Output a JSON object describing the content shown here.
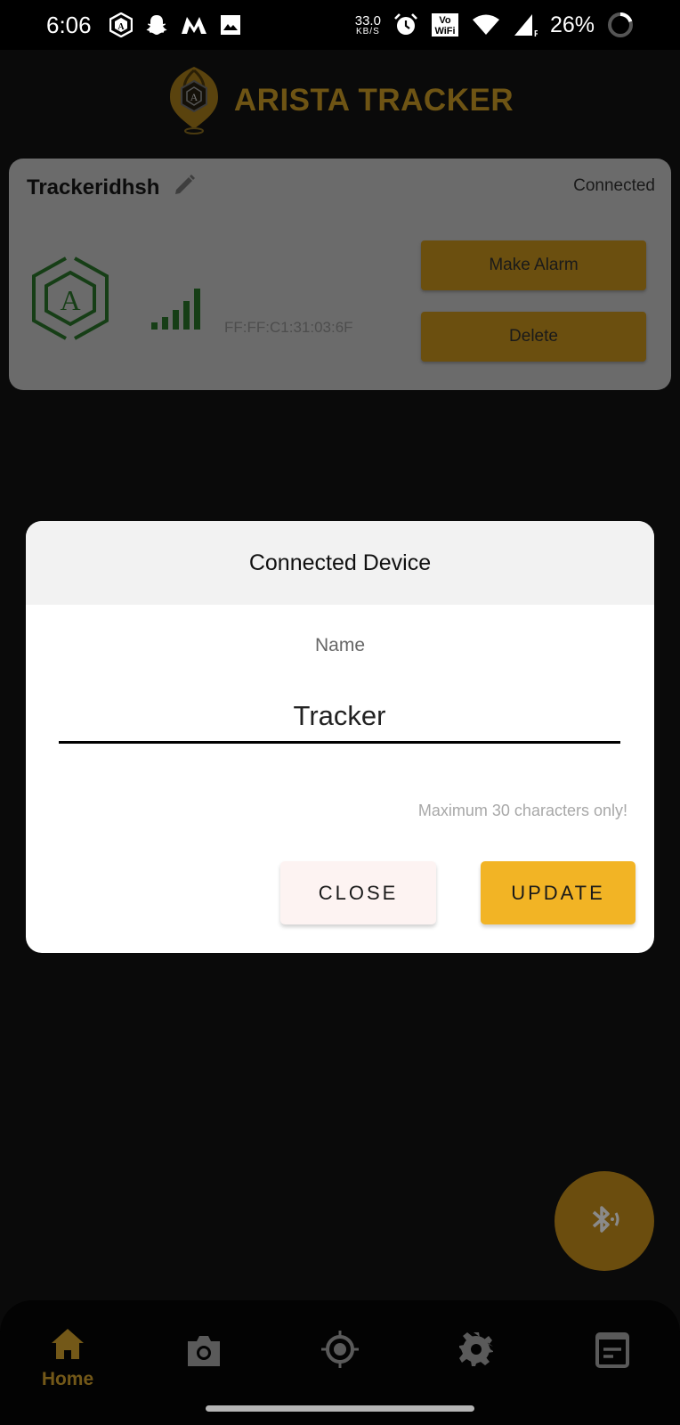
{
  "status_bar": {
    "time": "6:06",
    "notification_icons": [
      "arista-app-icon",
      "snapchat-icon",
      "myntra-icon",
      "gallery-icon"
    ],
    "net_speed_value": "33.0",
    "net_speed_unit": "KB/S",
    "system_icons": [
      "alarm-icon",
      "vowifi-icon",
      "wifi-icon",
      "cell-signal-roaming-icon"
    ],
    "battery_percent": "26%"
  },
  "header": {
    "app_title": "ARISTA TRACKER",
    "brand_color": "#6e5414"
  },
  "device_card": {
    "device_name": "Trackeridhsh",
    "connection_status": "Connected",
    "mac_address": "FF:FF:C1:31:03:6F",
    "signal_level": "4/4",
    "make_alarm_label": "Make Alarm",
    "delete_label": "Delete"
  },
  "dialog": {
    "title": "Connected Device",
    "field_label": "Name",
    "name_value": "Tracker",
    "hint": "Maximum 30 characters only!",
    "close_label": "CLOSE",
    "update_label": "UPDATE",
    "accent_color": "#f2b425"
  },
  "fab": {
    "icon": "bluetooth-audio-icon"
  },
  "bottom_nav": {
    "items": [
      {
        "id": "home",
        "label": "Home",
        "icon": "home-icon",
        "active": true
      },
      {
        "id": "camera",
        "label": "",
        "icon": "camera-icon",
        "active": false
      },
      {
        "id": "locate",
        "label": "",
        "icon": "gps-target-icon",
        "active": false
      },
      {
        "id": "settings",
        "label": "",
        "icon": "gear-icon",
        "active": false
      },
      {
        "id": "notes",
        "label": "",
        "icon": "notes-icon",
        "active": false
      }
    ]
  }
}
